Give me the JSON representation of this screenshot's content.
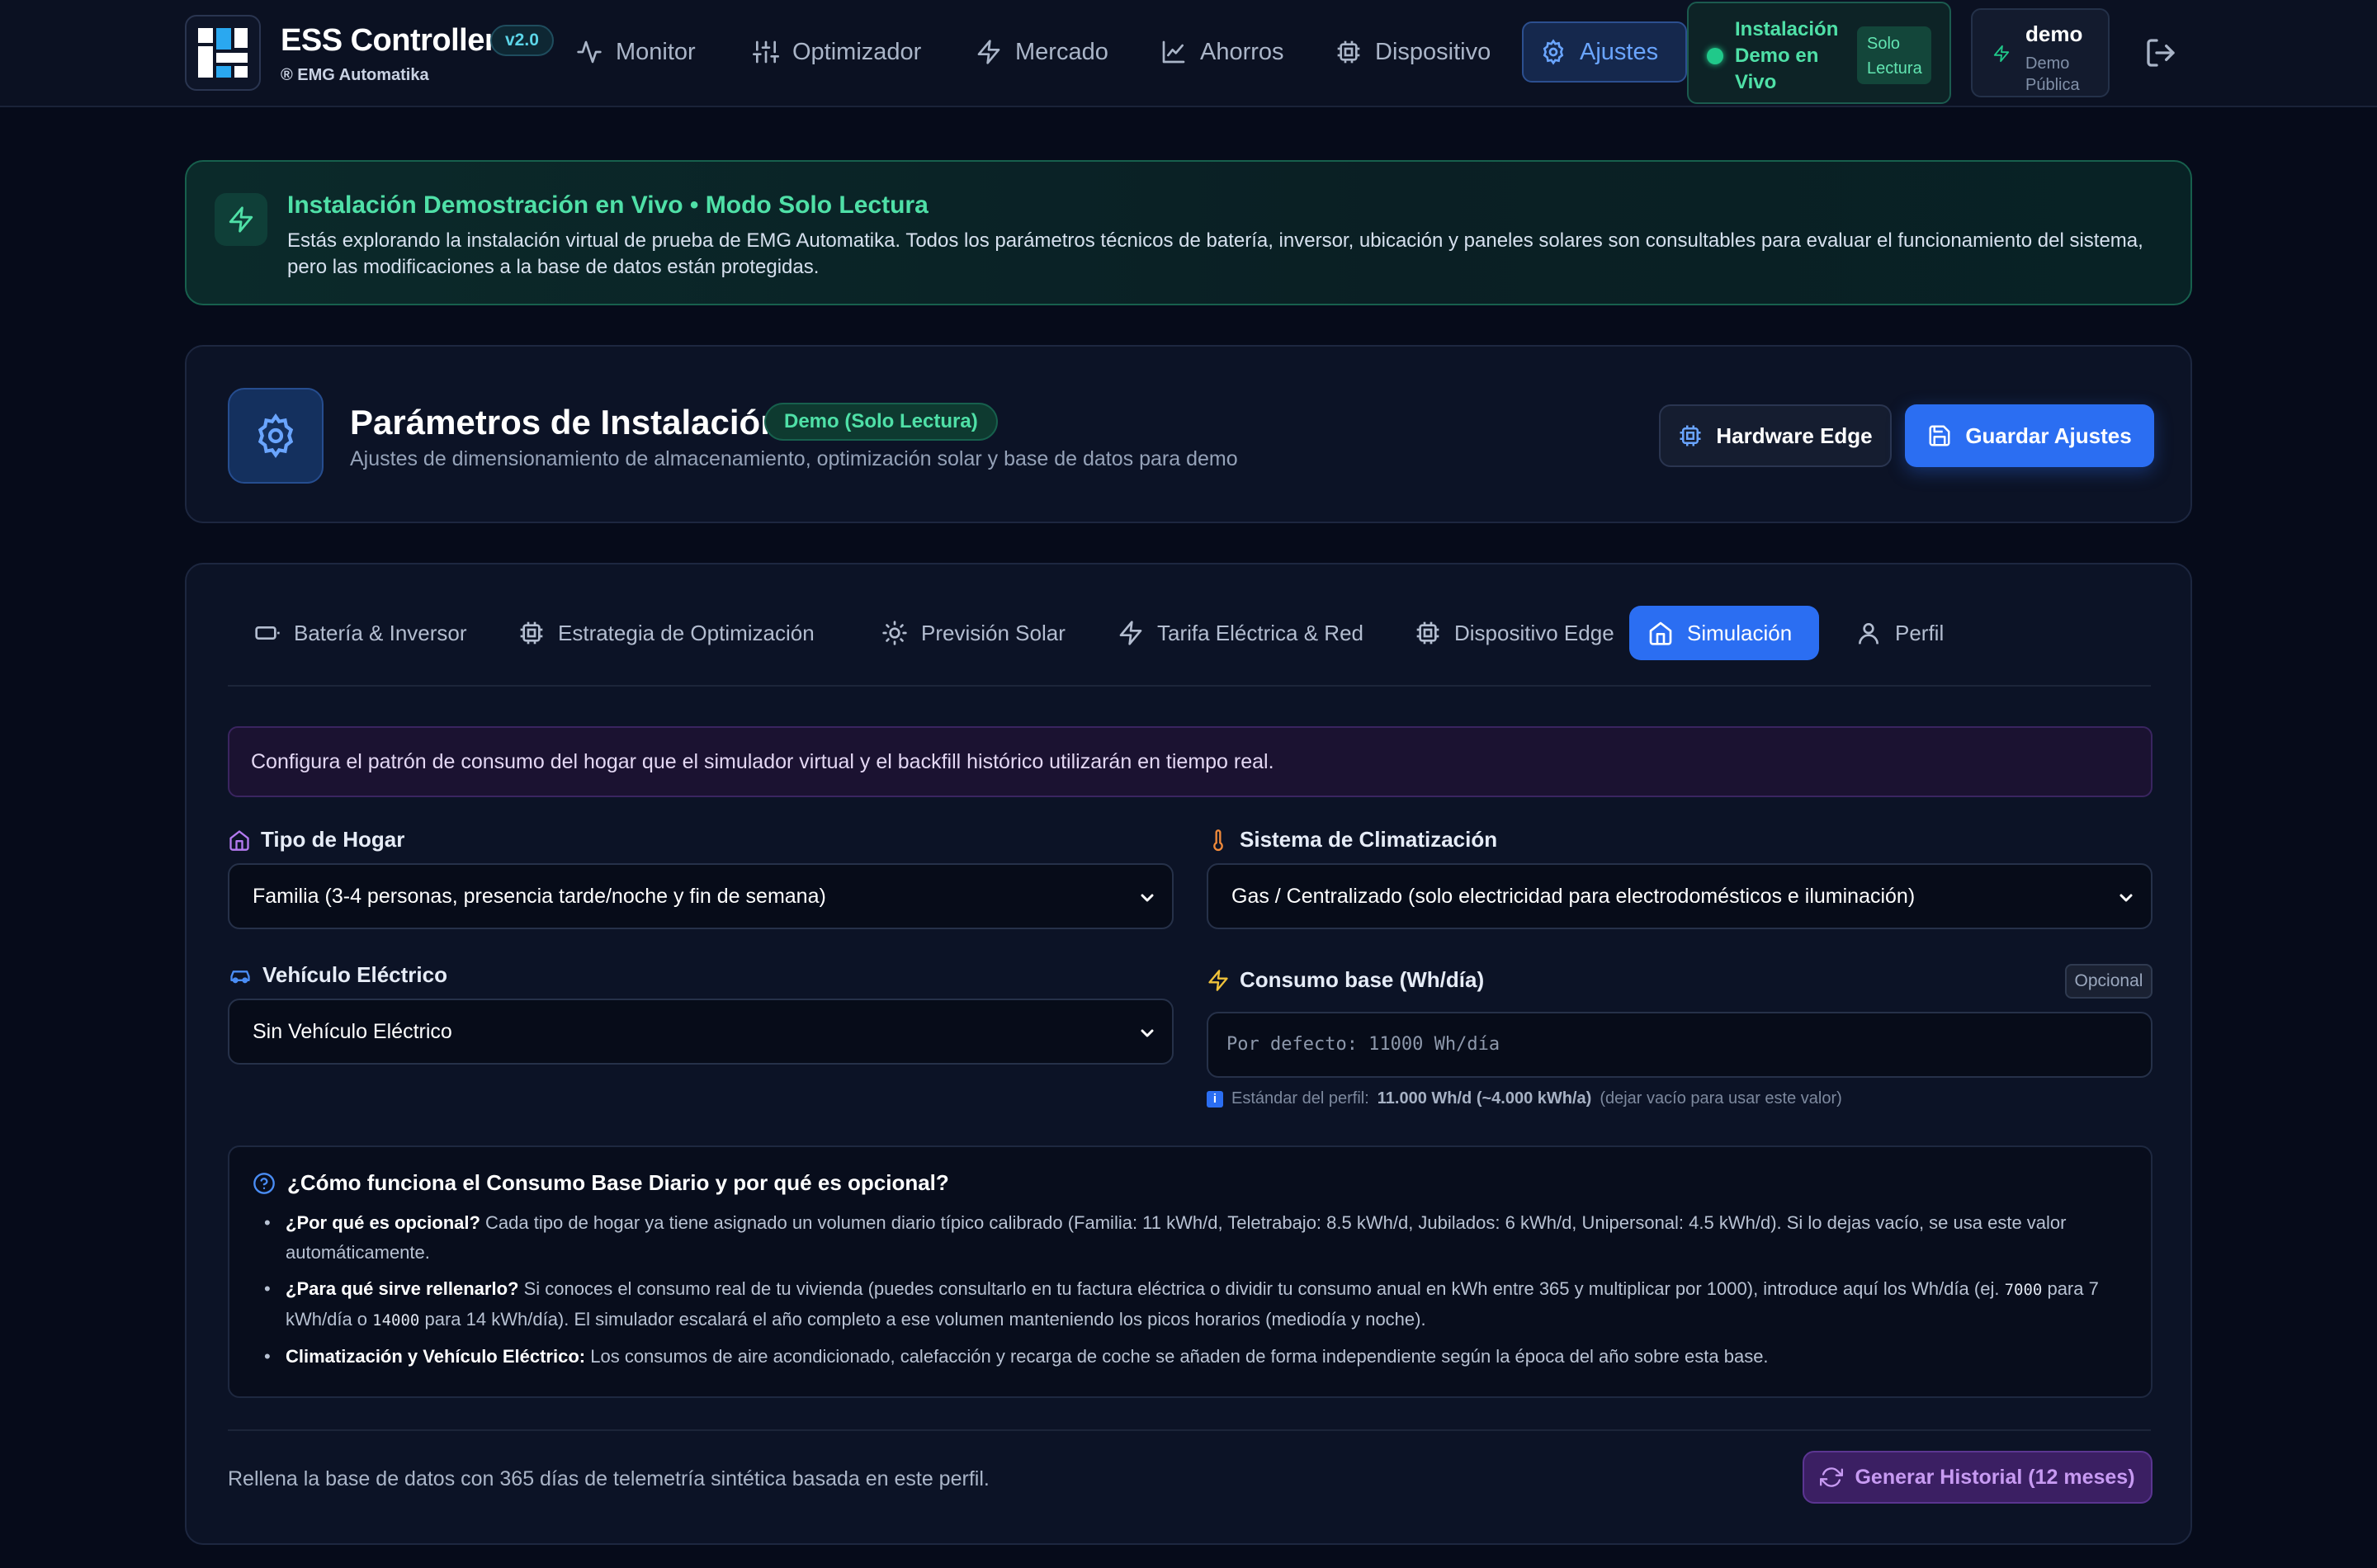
{
  "app": {
    "title": "ESS Controller",
    "version": "v2.0",
    "subtitle": "® EMG Automatika"
  },
  "nav": {
    "items": [
      {
        "label": "Monitor",
        "icon": "activity-icon"
      },
      {
        "label": "Optimizador",
        "icon": "sliders-icon"
      },
      {
        "label": "Mercado",
        "icon": "zap-icon"
      },
      {
        "label": "Ahorros",
        "icon": "line-chart-icon"
      },
      {
        "label": "Dispositivo",
        "icon": "cpu-icon"
      },
      {
        "label": "Ajustes",
        "icon": "gear-icon",
        "active": true
      }
    ],
    "demo_status": "Instalación Demo en Vivo",
    "demo_badge": "Solo Lectura",
    "user_name": "demo",
    "user_sub": "Demo Pública"
  },
  "banner": {
    "title": "Instalación Demostración en Vivo • Modo Solo Lectura",
    "text": "Estás explorando la instalación virtual de prueba de EMG Automatika. Todos los parámetros técnicos de batería, inversor, ubicación y paneles solares son consultables para evaluar el funcionamiento del sistema, pero las modificaciones a la base de datos están protegidas."
  },
  "header": {
    "title": "Parámetros de Instalación",
    "badge": "Demo (Solo Lectura)",
    "subtitle": "Ajustes de dimensionamiento de almacenamiento, optimización solar y base de datos para demo",
    "hardware_button": "Hardware Edge",
    "save_button": "Guardar Ajustes"
  },
  "tabs": [
    {
      "label": "Batería & Inversor",
      "icon": "battery-icon"
    },
    {
      "label": "Estrategia de Optimización",
      "icon": "cpu-icon"
    },
    {
      "label": "Previsión Solar",
      "icon": "sun-icon"
    },
    {
      "label": "Tarifa Eléctrica & Red",
      "icon": "zap-icon"
    },
    {
      "label": "Dispositivo Edge",
      "icon": "cpu-icon"
    },
    {
      "label": "Simulación",
      "icon": "home-icon",
      "active": true
    },
    {
      "label": "Perfil",
      "icon": "user-icon"
    }
  ],
  "simulation": {
    "info": "Configura el patrón de consumo del hogar que el simulador virtual y el backfill histórico utilizarán en tiempo real.",
    "household_label": "Tipo de Hogar",
    "household_value": "Familia (3-4 personas, presencia tarde/noche y fin de semana)",
    "climate_label": "Sistema de Climatización",
    "climate_value": "Gas / Centralizado (solo electricidad para electrodomésticos e iluminación)",
    "ev_label": "Vehículo Eléctrico",
    "ev_value": "Sin Vehículo Eléctrico",
    "base_label": "Consumo base (Wh/día)",
    "optional_badge": "Opcional",
    "base_placeholder": "Por defecto: 11000 Wh/día",
    "hint_prefix": "Estándar del perfil:",
    "hint_value": "11.000 Wh/d (~4.000 kWh/a)",
    "hint_suffix": "(dejar vacío para usar este valor)"
  },
  "faq": {
    "title": "¿Cómo funciona el Consumo Base Diario y por qué es opcional?",
    "q1_title": "¿Por qué es opcional?",
    "q1_text": "Cada tipo de hogar ya tiene asignado un volumen diario típico calibrado (Familia: 11 kWh/d, Teletrabajo: 8.5 kWh/d, Jubilados: 6 kWh/d, Unipersonal: 4.5 kWh/d). Si lo dejas vacío, se usa este valor automáticamente.",
    "q2_title": "¿Para qué sirve rellenarlo?",
    "q2_text_a": "Si conoces el consumo real de tu vivienda (puedes consultarlo en tu factura eléctrica o dividir tu consumo anual en kWh entre 365 y multiplicar por 1000), introduce aquí los Wh/día (ej.",
    "q2_code_a": "7000",
    "q2_text_b": "para 7 kWh/día o",
    "q2_code_b": "14000",
    "q2_text_c": "para 14 kWh/día). El simulador escalará el año completo a ese volumen manteniendo los picos horarios (mediodía y noche).",
    "q3_title": "Climatización y Vehículo Eléctrico:",
    "q3_text": "Los consumos de aire acondicionado, calefacción y recarga de coche se añaden de forma independiente según la época del año sobre esta base."
  },
  "footer": {
    "text": "Rellena la base de datos con 365 días de telemetría sintética basada en este perfil.",
    "generate_button": "Generar Historial (12 meses)"
  },
  "colors": {
    "accent": "#2b6ef2",
    "success": "#4fe0a7",
    "purple": "#c79af2",
    "background": "#060b1a"
  }
}
